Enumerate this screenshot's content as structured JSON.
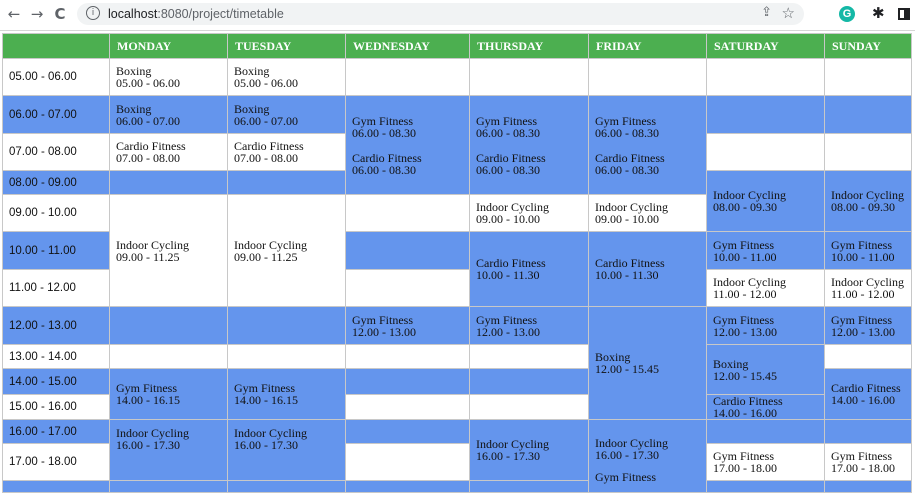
{
  "browser": {
    "nav": {
      "back": "←",
      "forward": "→",
      "reload": "C"
    },
    "url_host": "localhost",
    "url_path": ":8080/project/timetable"
  },
  "timetable": {
    "days": [
      "MONDAY",
      "TUESDAY",
      "WEDNESDAY",
      "THURSDAY",
      "FRIDAY",
      "SATURDAY",
      "SUNDAY"
    ],
    "slots": [
      "05.00 - 06.00",
      "06.00 - 07.00",
      "07.00 - 08.00",
      "08.00 - 09.00",
      "09.00 - 10.00",
      "10.00 - 11.00",
      "11.00 - 12.00",
      "12.00 - 13.00",
      "13.00 - 14.00",
      "14.00 - 15.00",
      "15.00 - 16.00",
      "16.00 - 17.00",
      "17.00 - 18.00"
    ],
    "classes": {
      "mon_boxing_0500": {
        "name": "Boxing",
        "time": "05.00 - 06.00"
      },
      "tue_boxing_0500": {
        "name": "Boxing",
        "time": "05.00 - 06.00"
      },
      "mon_boxing_0600": {
        "name": "Boxing",
        "time": "06.00 - 07.00"
      },
      "tue_boxing_0600": {
        "name": "Boxing",
        "time": "06.00 - 07.00"
      },
      "wed_gym_0600": {
        "name": "Gym Fitness",
        "time": "06.00 - 08.30"
      },
      "thu_gym_0600": {
        "name": "Gym Fitness",
        "time": "06.00 - 08.30"
      },
      "fri_gym_0600": {
        "name": "Gym Fitness",
        "time": "06.00 - 08.30"
      },
      "mon_cardio_0700": {
        "name": "Cardio Fitness",
        "time": "07.00 - 08.00"
      },
      "tue_cardio_0700": {
        "name": "Cardio Fitness",
        "time": "07.00 - 08.00"
      },
      "wed_cardio_0600": {
        "name": "Cardio Fitness",
        "time": "06.00 - 08.30"
      },
      "thu_cardio_0600": {
        "name": "Cardio Fitness",
        "time": "06.00 - 08.30"
      },
      "fri_cardio_0600": {
        "name": "Cardio Fitness",
        "time": "06.00 - 08.30"
      },
      "sat_cycling_0800": {
        "name": "Indoor Cycling",
        "time": "08.00 - 09.30"
      },
      "sun_cycling_0800": {
        "name": "Indoor Cycling",
        "time": "08.00 - 09.30"
      },
      "mon_cycling_0900": {
        "name": "Indoor Cycling",
        "time": "09.00 - 11.25"
      },
      "tue_cycling_0900": {
        "name": "Indoor Cycling",
        "time": "09.00 - 11.25"
      },
      "thu_cycling_0900": {
        "name": "Indoor Cycling",
        "time": "09.00 - 10.00"
      },
      "fri_cycling_0900": {
        "name": "Indoor Cycling",
        "time": "09.00 - 10.00"
      },
      "thu_cardio_1000": {
        "name": "Cardio Fitness",
        "time": "10.00 - 11.30"
      },
      "fri_cardio_1000": {
        "name": "Cardio Fitness",
        "time": "10.00 - 11.30"
      },
      "sat_gym_1000": {
        "name": "Gym Fitness",
        "time": "10.00 - 11.00"
      },
      "sun_gym_1000": {
        "name": "Gym Fitness",
        "time": "10.00 - 11.00"
      },
      "sat_cycling_1100": {
        "name": "Indoor Cycling",
        "time": "11.00 - 12.00"
      },
      "sun_cycling_1100": {
        "name": "Indoor Cycling",
        "time": "11.00 - 12.00"
      },
      "wed_gym_1200": {
        "name": "Gym Fitness",
        "time": "12.00 - 13.00"
      },
      "thu_gym_1200": {
        "name": "Gym Fitness",
        "time": "12.00 - 13.00"
      },
      "sat_gym_1200": {
        "name": "Gym Fitness",
        "time": "12.00 - 13.00"
      },
      "sun_gym_1200": {
        "name": "Gym Fitness",
        "time": "12.00 - 13.00"
      },
      "fri_boxing_1200": {
        "name": "Boxing",
        "time": "12.00 - 15.45"
      },
      "sat_boxing_1200": {
        "name": "Boxing",
        "time": "12.00 - 15.45"
      },
      "sun_cardio_1400": {
        "name": "Cardio Fitness",
        "time": "14.00 - 16.00"
      },
      "sat_cardio_1400": {
        "name": "Cardio Fitness",
        "time": "14.00 - 16.00"
      },
      "mon_gym_1400": {
        "name": "Gym Fitness",
        "time": "14.00 - 16.15"
      },
      "tue_gym_1400": {
        "name": "Gym Fitness",
        "time": "14.00 - 16.15"
      },
      "mon_cycling_1600": {
        "name": "Indoor Cycling",
        "time": "16.00 - 17.30"
      },
      "tue_cycling_1600": {
        "name": "Indoor Cycling",
        "time": "16.00 - 17.30"
      },
      "thu_cycling_1600": {
        "name": "Indoor Cycling",
        "time": "16.00 - 17.30"
      },
      "fri_cycling_1600": {
        "name": "Indoor Cycling",
        "time": "16.00 - 17.30"
      },
      "sat_gym_1700": {
        "name": "Gym Fitness",
        "time": "17.00 - 18.00"
      },
      "sun_gym_1700": {
        "name": "Gym Fitness",
        "time": "17.00 - 18.00"
      },
      "fri_gym_partial": {
        "name": "Gym Fitness"
      }
    }
  },
  "colors": {
    "header_green": "#4caf50",
    "highlight_blue": "#6495ed"
  }
}
